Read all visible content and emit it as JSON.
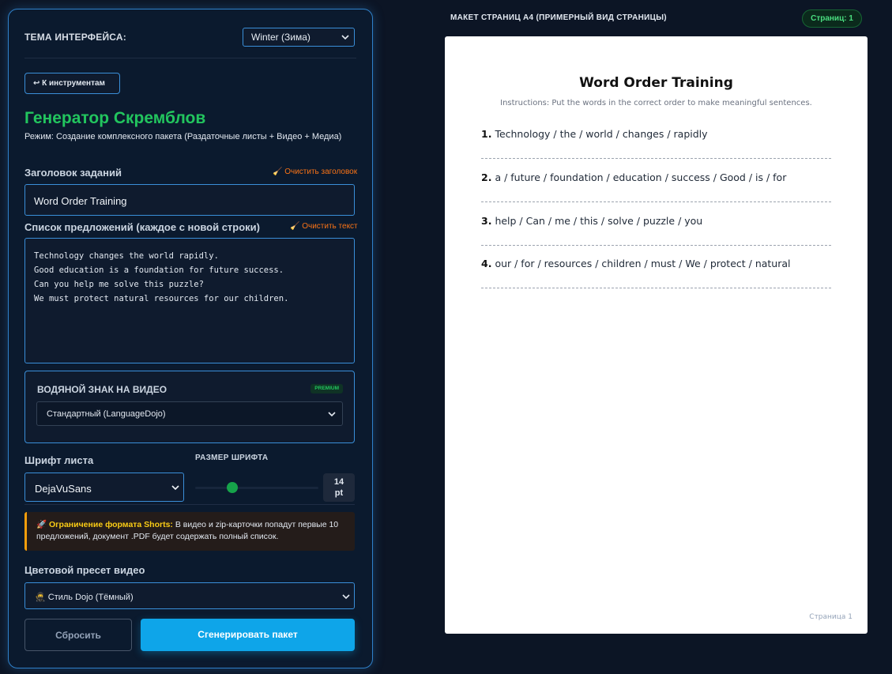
{
  "theme": {
    "label": "ТЕМА ИНТЕРФЕЙСА:",
    "selected": "Winter (Зима)"
  },
  "back_button": "↩ К инструментам",
  "title": "Генератор Скремблов",
  "subtitle": "Режим: Создание комплексного пакета (Раздаточные листы + Видео + Медиа)",
  "task_title": {
    "label": "Заголовок заданий",
    "clear_label": "🧹 Очистить заголовок",
    "value": "Word Order Training"
  },
  "sentences": {
    "label": "Список предложений (каждое с новой строки)",
    "clear_label": "🧹 Очистить текст",
    "lines": [
      "Technology changes the world rapidly.",
      "Good education is a foundation for future success.",
      "Can you help me solve this puzzle?",
      "We must protect natural resources for our children."
    ]
  },
  "watermark": {
    "label": "ВОДЯНОЙ ЗНАК НА ВИДЕО",
    "badge": "PREMIUM",
    "selected": "Стандартный (LanguageDojo)"
  },
  "font": {
    "label": "Шрифт листа",
    "selected": "DejaVuSans"
  },
  "font_size": {
    "label": "РАЗМЕР ШРИФТА",
    "value": "14",
    "unit": "pt",
    "slider_fraction": 0.27
  },
  "warning": {
    "title": "🚀 Ограничение формата Shorts:",
    "text": " В видео и zip-карточки попадут первые 10 предложений, документ .PDF будет содержать полный список."
  },
  "preset": {
    "label": "Цветовой пресет видео",
    "selected": "🥷 Стиль Dojo (Тёмный)"
  },
  "buttons": {
    "reset": "Сбросить",
    "generate": "Сгенерировать пакет"
  },
  "preview": {
    "heading": "МАКЕТ СТРАНИЦ А4 (ПРИМЕРНЫЙ ВИД СТРАНИЦЫ)",
    "page_count": "Страниц: 1",
    "doc_title": "Word Order Training",
    "instructions": "Instructions: Put the words in the correct order to make meaningful sentences.",
    "items": [
      {
        "num": "1.",
        "text": "Technology / the / world / changes / rapidly"
      },
      {
        "num": "2.",
        "text": "a / future / foundation / education / success / Good / is / for"
      },
      {
        "num": "3.",
        "text": "help / Can / me / this / solve / puzzle / you"
      },
      {
        "num": "4.",
        "text": "our / for / resources / children / must / We / protect / natural"
      }
    ],
    "footer": "Страница 1"
  },
  "colors": {
    "accent_blue": "#3a8fd9",
    "title_green": "#22c55e",
    "generate_button": "#0ea5e9",
    "warning_border": "#f59e0b",
    "clear_link": "#f97316"
  }
}
